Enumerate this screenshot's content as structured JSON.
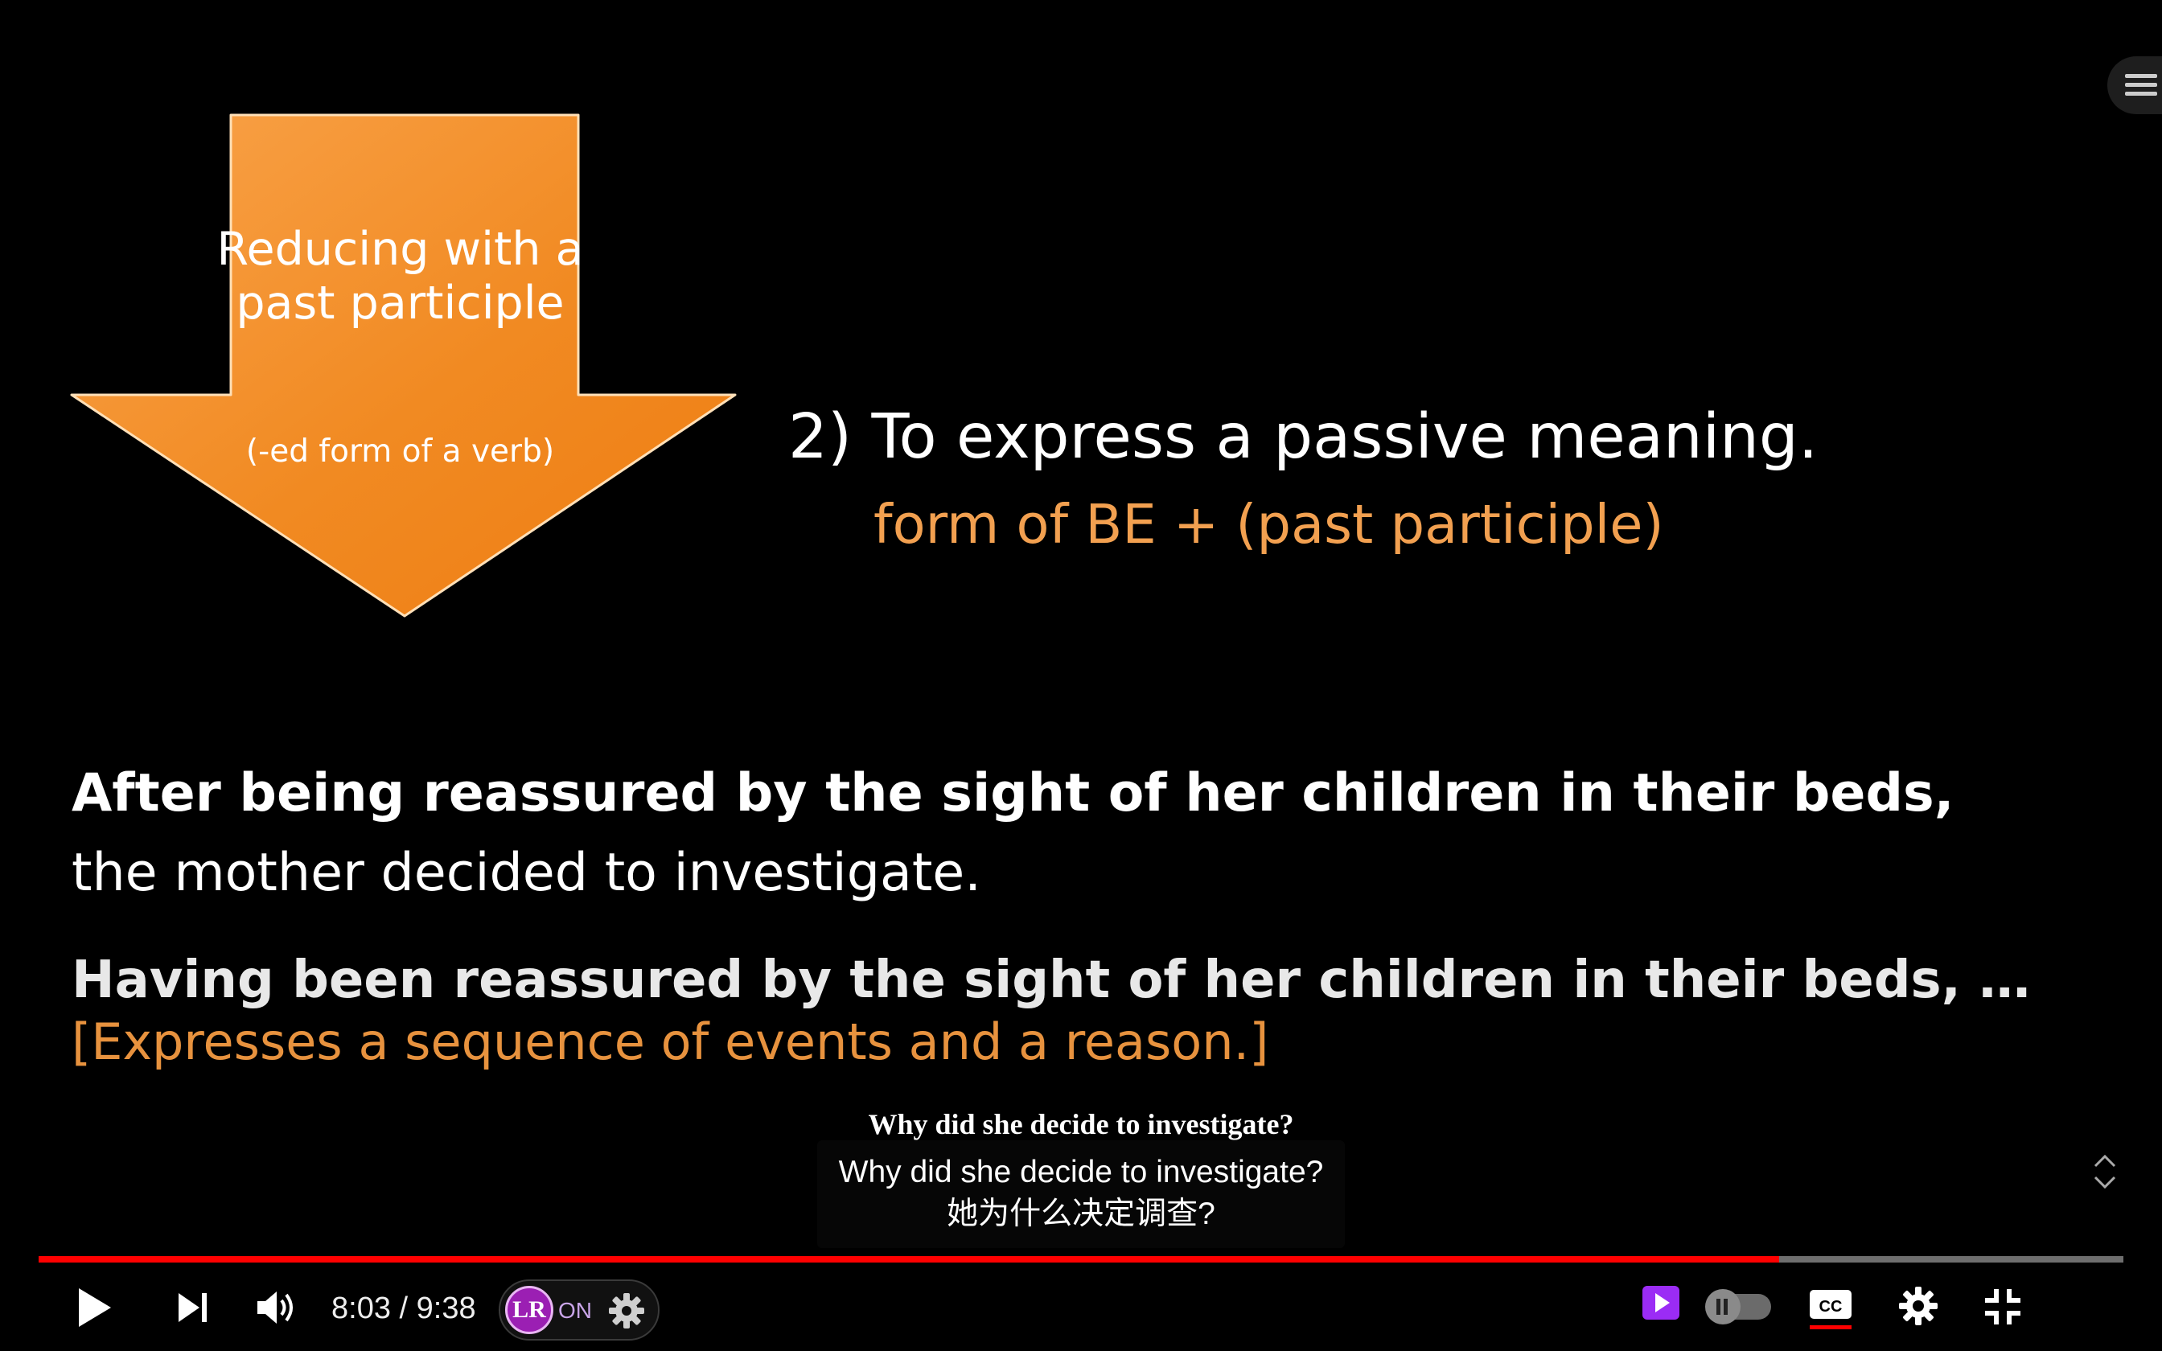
{
  "slide": {
    "arrow": {
      "title": "Reducing with a past participle",
      "subtitle": "(-ed form of a verb)"
    },
    "point_title": "2) To express a passive meaning.",
    "formula": "form of BE + (past participle)",
    "example1_line1": "After being reassured by the sight of her children in their beds,",
    "example1_line2": "the mother decided to investigate.",
    "example2_line1": "Having been reassured by the sight of her children in their beds, …",
    "example2_line2": "[Expresses a sequence of events and a reason.]"
  },
  "subtitles": {
    "burned_in": "Why did she decide to investigate?",
    "cc_english": "Why did she decide to investigate?",
    "cc_chinese": "她为什么决定调查?"
  },
  "player": {
    "current_time": "8:03",
    "duration": "9:38",
    "time_separator": "/",
    "progress": 0.835,
    "extension": {
      "logo_text": "LR",
      "status": "ON"
    },
    "icons": {
      "play": "play-icon",
      "next": "next-icon",
      "volume": "volume-icon",
      "extension_settings": "gear-icon",
      "miniplayer": "play-square-icon",
      "autoplay": "pause-toggle-icon",
      "captions": "cc-icon",
      "settings": "gear-icon",
      "exit_fullscreen": "exit-fullscreen-icon",
      "menu": "menu-icon",
      "caption_position": "up-down-chevron-icon"
    }
  },
  "colors": {
    "arrow_light": "#f9a34a",
    "arrow_dark": "#ee7d12",
    "formula": "#f2a050",
    "reason": "#e7923e",
    "progress_played": "#ff0000",
    "extension_accent": "#9b1fb3"
  }
}
